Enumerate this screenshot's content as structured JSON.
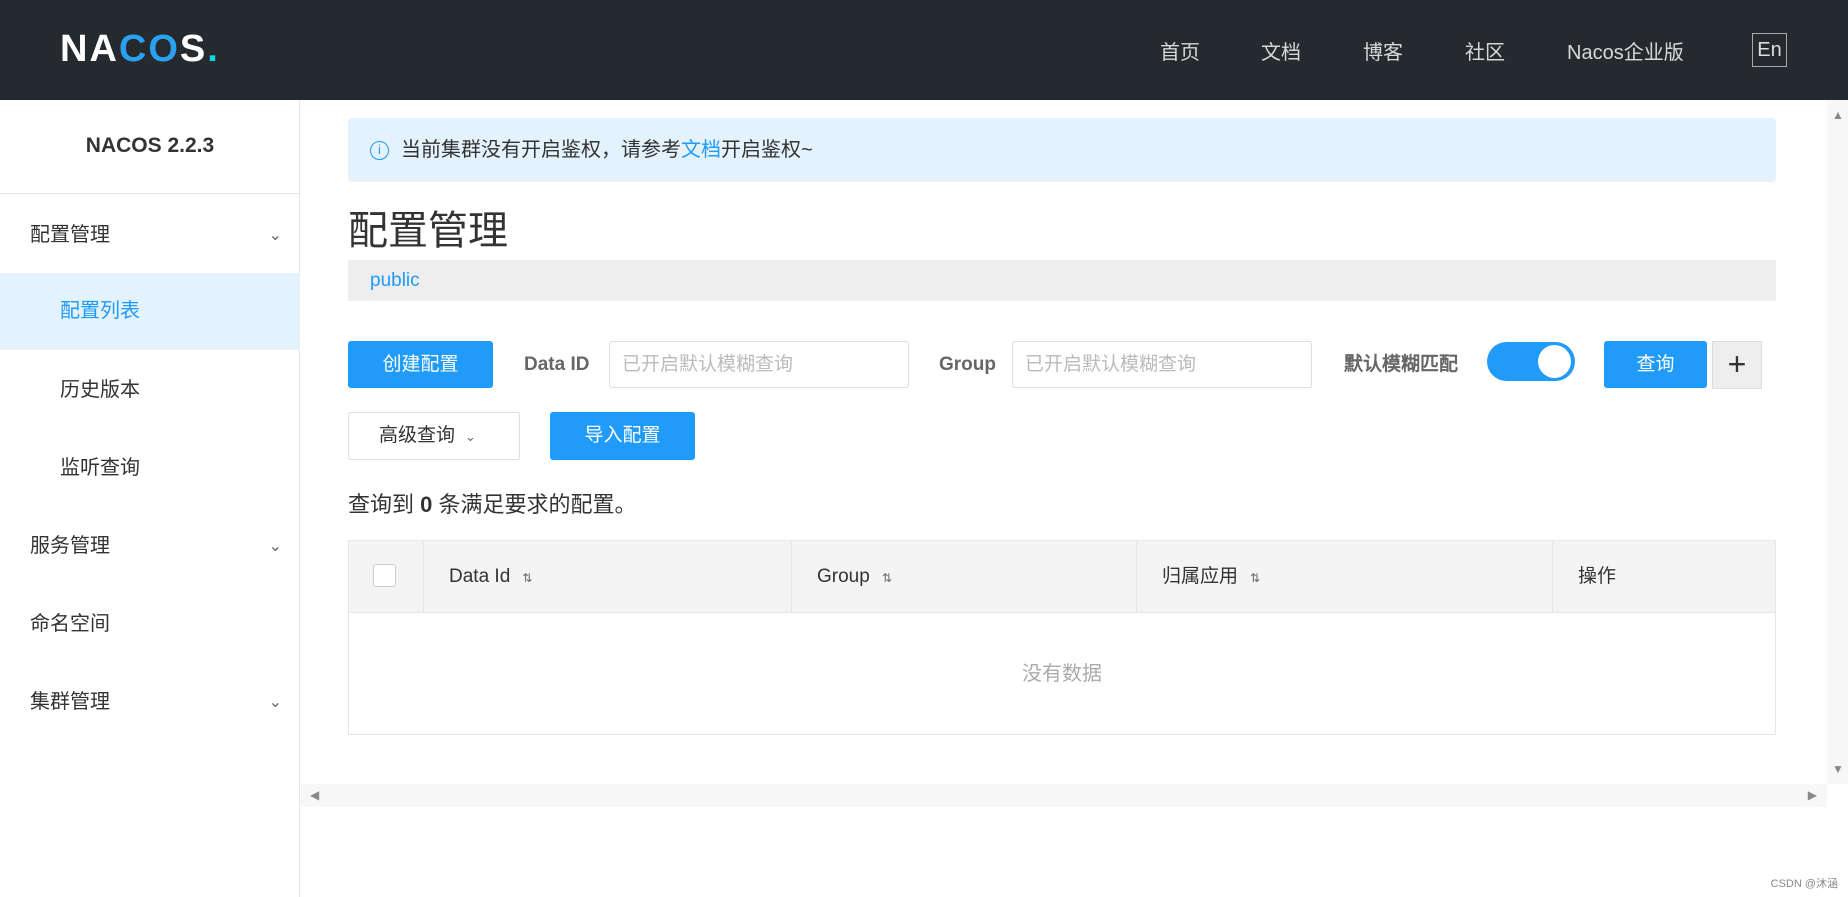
{
  "header": {
    "logo": "NACOS.",
    "nav": [
      "首页",
      "文档",
      "博客",
      "社区",
      "Nacos企业版"
    ],
    "lang": "En"
  },
  "sidebar": {
    "version": "NACOS 2.2.3",
    "items": [
      {
        "label": "配置管理"
      },
      {
        "label": "配置列表"
      },
      {
        "label": "历史版本"
      },
      {
        "label": "监听查询"
      },
      {
        "label": "服务管理"
      },
      {
        "label": "命名空间"
      },
      {
        "label": "集群管理"
      }
    ]
  },
  "notice": {
    "before": "当前集群没有开启鉴权，请参考",
    "link": "文档",
    "after": "开启鉴权~"
  },
  "page_title": "配置管理",
  "namespace": "public",
  "toolbar": {
    "create": "创建配置",
    "data_id_label": "Data ID",
    "data_id_placeholder": "已开启默认模糊查询",
    "group_label": "Group",
    "group_placeholder": "已开启默认模糊查询",
    "fuzzy_label": "默认模糊匹配",
    "fuzzy_on": true,
    "query": "查询",
    "advanced": "高级查询",
    "import": "导入配置"
  },
  "result": {
    "prefix": "查询到",
    "count": "0",
    "suffix": "条满足要求的配置。"
  },
  "table": {
    "columns": [
      "Data Id",
      "Group",
      "归属应用",
      "操作"
    ],
    "empty": "没有数据"
  },
  "watermark": "CSDN @沐涵"
}
